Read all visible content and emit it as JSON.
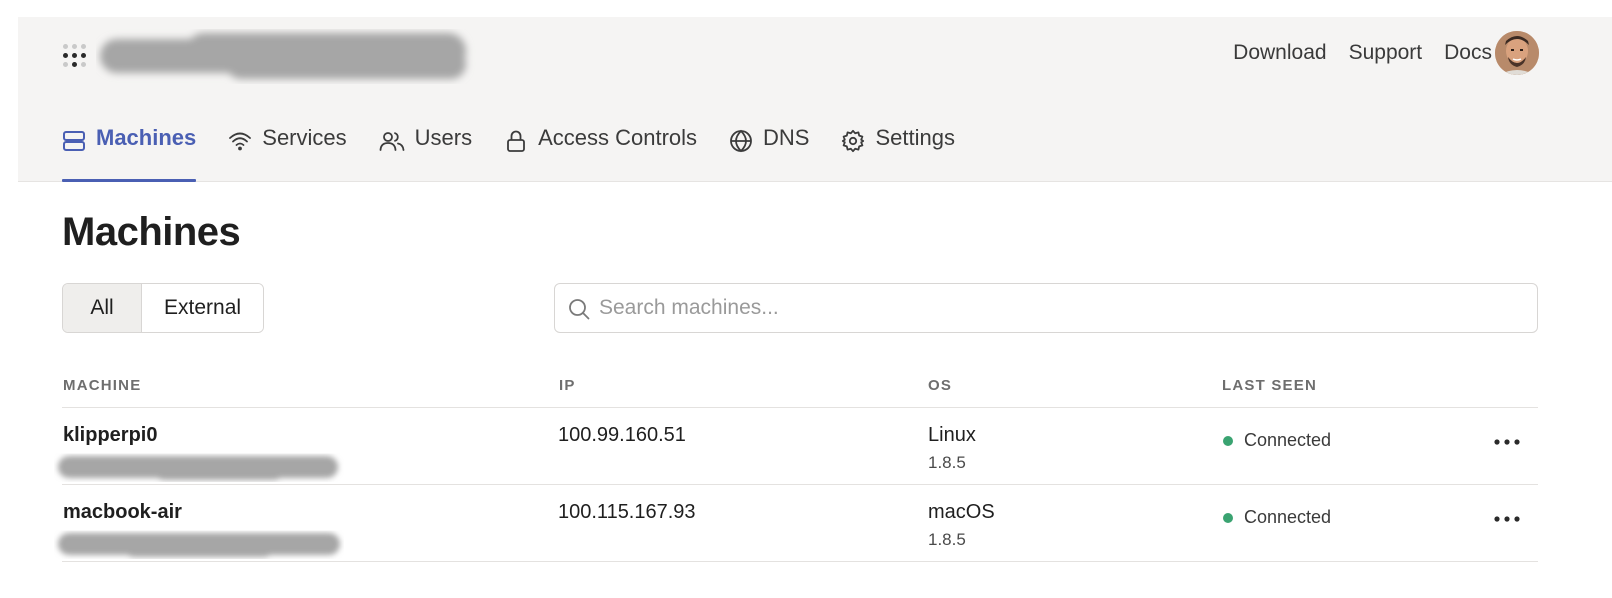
{
  "header": {
    "tailnet_name_redacted": true,
    "links": [
      "Download",
      "Support",
      "Docs"
    ]
  },
  "nav": {
    "items": [
      {
        "label": "Machines",
        "icon": "server-icon",
        "active": true
      },
      {
        "label": "Services",
        "icon": "wifi-icon",
        "active": false
      },
      {
        "label": "Users",
        "icon": "users-icon",
        "active": false
      },
      {
        "label": "Access Controls",
        "icon": "lock-icon",
        "active": false
      },
      {
        "label": "DNS",
        "icon": "globe-icon",
        "active": false
      },
      {
        "label": "Settings",
        "icon": "gear-icon",
        "active": false
      }
    ]
  },
  "page": {
    "title": "Machines",
    "filters": [
      "All",
      "External"
    ],
    "active_filter": "All",
    "search_placeholder": "Search machines..."
  },
  "table": {
    "columns": [
      "MACHINE",
      "IP",
      "OS",
      "LAST SEEN"
    ],
    "rows": [
      {
        "machine": "klipperpi0",
        "ip": "100.99.160.51",
        "os": "Linux",
        "version": "1.8.5",
        "last_seen": "Connected"
      },
      {
        "machine": "macbook-air",
        "ip": "100.115.167.93",
        "os": "macOS",
        "version": "1.8.5",
        "last_seen": "Connected"
      }
    ]
  },
  "colors": {
    "accent": "#4a5fb3",
    "connected": "#3aa371",
    "header_bg": "#f5f4f3"
  }
}
